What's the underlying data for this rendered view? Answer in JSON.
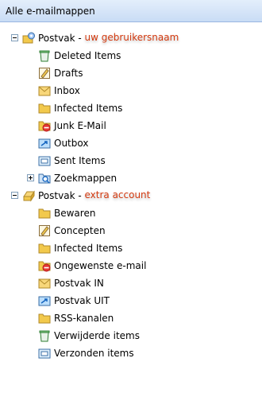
{
  "header": {
    "title": "Alle e-mailmappen"
  },
  "account1": {
    "name": "Postvak",
    "separator": " - ",
    "suffix": "uw gebruikersnaam",
    "folders": [
      {
        "label": "Deleted Items",
        "icon": "deleted-items-icon"
      },
      {
        "label": "Drafts",
        "icon": "drafts-icon"
      },
      {
        "label": "Inbox",
        "icon": "inbox-icon"
      },
      {
        "label": "Infected Items",
        "icon": "folder-icon"
      },
      {
        "label": "Junk E-Mail",
        "icon": "junk-mail-icon"
      },
      {
        "label": "Outbox",
        "icon": "outbox-icon"
      },
      {
        "label": "Sent Items",
        "icon": "sent-items-icon"
      }
    ],
    "search": {
      "label": "Zoekmappen",
      "icon": "search-folders-icon"
    }
  },
  "account2": {
    "name": "Postvak",
    "separator": " - ",
    "suffix": "extra account",
    "folders": [
      {
        "label": "Bewaren",
        "icon": "folder-icon"
      },
      {
        "label": "Concepten",
        "icon": "drafts-icon"
      },
      {
        "label": "Infected Items",
        "icon": "folder-icon"
      },
      {
        "label": "Ongewenste e-mail",
        "icon": "junk-mail-icon"
      },
      {
        "label": "Postvak IN",
        "icon": "inbox-icon"
      },
      {
        "label": "Postvak UIT",
        "icon": "outbox-icon"
      },
      {
        "label": "RSS-kanalen",
        "icon": "folder-icon"
      },
      {
        "label": "Verwijderde items",
        "icon": "deleted-items-icon"
      },
      {
        "label": "Verzonden items",
        "icon": "sent-items-icon"
      }
    ]
  },
  "colors": {
    "accent_text": "#d33a10",
    "folder": "#f2c94c",
    "header_bg": "#c9dcf5"
  }
}
